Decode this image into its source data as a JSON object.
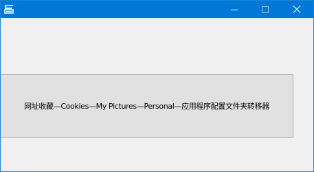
{
  "window": {
    "title": "",
    "titlebar_color": "#0078d7",
    "client_color": "#f0f0f0",
    "border_color": "#1883d7"
  },
  "titlebar": {
    "app_icon": "app-logo-icon",
    "controls": {
      "minimize_icon": "minimize-icon",
      "maximize_icon": "maximize-icon",
      "close_icon": "close-icon"
    }
  },
  "main": {
    "button_label": "网址收藏—Cookies—My Pictures—Personal—应用程序配置文件夹转移器",
    "button_color": "#e1e1e1",
    "button_border_color": "#adadad"
  }
}
